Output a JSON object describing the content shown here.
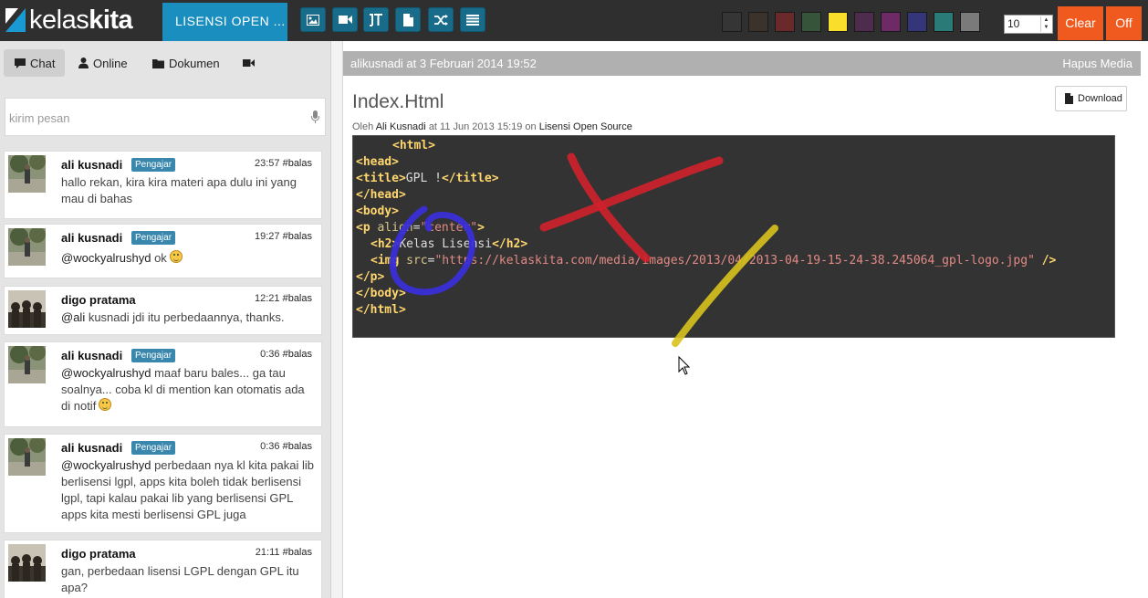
{
  "app": {
    "logo_light": "kelas",
    "logo_bold": "kita",
    "channel_title": "LISENSI OPEN ..."
  },
  "toolbar": {
    "tools": [
      {
        "name": "image-tool",
        "icon": "image-icon"
      },
      {
        "name": "video-tool",
        "icon": "video-camera-icon"
      },
      {
        "name": "text-tool",
        "icon": "text-height-icon"
      },
      {
        "name": "file-tool",
        "icon": "file-icon"
      },
      {
        "name": "shuffle-tool",
        "icon": "shuffle-icon"
      },
      {
        "name": "list-tool",
        "icon": "list-icon"
      }
    ],
    "colors": [
      "#353535",
      "#3b322b",
      "#6a2a2c",
      "#35543a",
      "#f9de2c",
      "#4d2c4d",
      "#6e2a64",
      "#35357a",
      "#2a7a78",
      "#7a7a7a"
    ],
    "brush_size": "10",
    "clear_label": "Clear",
    "off_label": "Off"
  },
  "sidebar": {
    "tabs": [
      {
        "label": "Chat",
        "icon": "comment-icon",
        "active": true
      },
      {
        "label": "Online",
        "icon": "user-icon",
        "active": false
      },
      {
        "label": "Dokumen",
        "icon": "folder-icon",
        "active": false
      },
      {
        "label": "",
        "icon": "video-camera-icon",
        "active": false
      }
    ],
    "message_placeholder": "kirim pesan",
    "messages": [
      {
        "name": "ali kusnadi",
        "badge": "Pengajar",
        "time": "23:57",
        "reply": "#balas",
        "mention": "",
        "text": "hallo rekan, kira kira materi apa dulu ini yang mau di bahas"
      },
      {
        "name": "ali kusnadi",
        "badge": "Pengajar",
        "time": "19:27",
        "reply": "#balas",
        "mention": "@wockyalrushyd",
        "text": " ok"
      },
      {
        "name": "digo pratama",
        "badge": "",
        "time": "12:21",
        "reply": "#balas",
        "mention": "@ali",
        "text": " kusnadi jdi itu perbedaannya, thanks."
      },
      {
        "name": "ali kusnadi",
        "badge": "Pengajar",
        "time": "0:36",
        "reply": "#balas",
        "mention": "@wockyalrushyd",
        "text": " maaf baru bales... ga tau soalnya... coba kl di mention kan otomatis ada di notif"
      },
      {
        "name": "ali kusnadi",
        "badge": "Pengajar",
        "time": "0:36",
        "reply": "#balas",
        "mention": "@wockyalrushyd",
        "text": " perbedaan nya kl kita pakai lib berlisensi lgpl, apps kita boleh tidak berlisensi lgpl, tapi kalau pakai lib yang berlisensi GPL apps kita mesti berlisensi GPL juga"
      },
      {
        "name": "digo pratama",
        "badge": "",
        "time": "21:11",
        "reply": "#balas",
        "mention": "",
        "text": "gan, perbedaan lisensi LGPL dengan GPL itu apa?"
      }
    ]
  },
  "main": {
    "header_left": "alikusnadi at 3 Februari 2014 19:52",
    "header_right": "Hapus Media",
    "doc_title": "Index.Html",
    "download_label": "Download",
    "meta": {
      "prefix": "Oleh",
      "author": "Ali Kusnadi",
      "mid": "at 11 Jun 2013 15:19 on",
      "category": "Lisensi Open Source"
    },
    "code": {
      "l1": "<html>",
      "l2": "<head>",
      "l3_open": "<title>",
      "l3_text": "GPL !",
      "l3_close": "</title>",
      "l4": "</head>",
      "l5": "<body>",
      "l6_open": "<p",
      "l6_attr": "align",
      "l6_eq": "=",
      "l6_val": "\"center\"",
      "l6_close": ">",
      "l7_open": "<h2>",
      "l7_text": "Kelas Lisensi",
      "l7_close": "</h2>",
      "l8_open": "<img",
      "l8_attr": "src",
      "l8_eq": "=",
      "l8_val": "\"https://kelaskita.com/media/images/2013/04/2013-04-19-15-24-38.245064_gpl-logo.jpg\"",
      "l8_close": "/>",
      "l9": "</p>",
      "l10": "</body>",
      "l11": "</html>"
    }
  }
}
